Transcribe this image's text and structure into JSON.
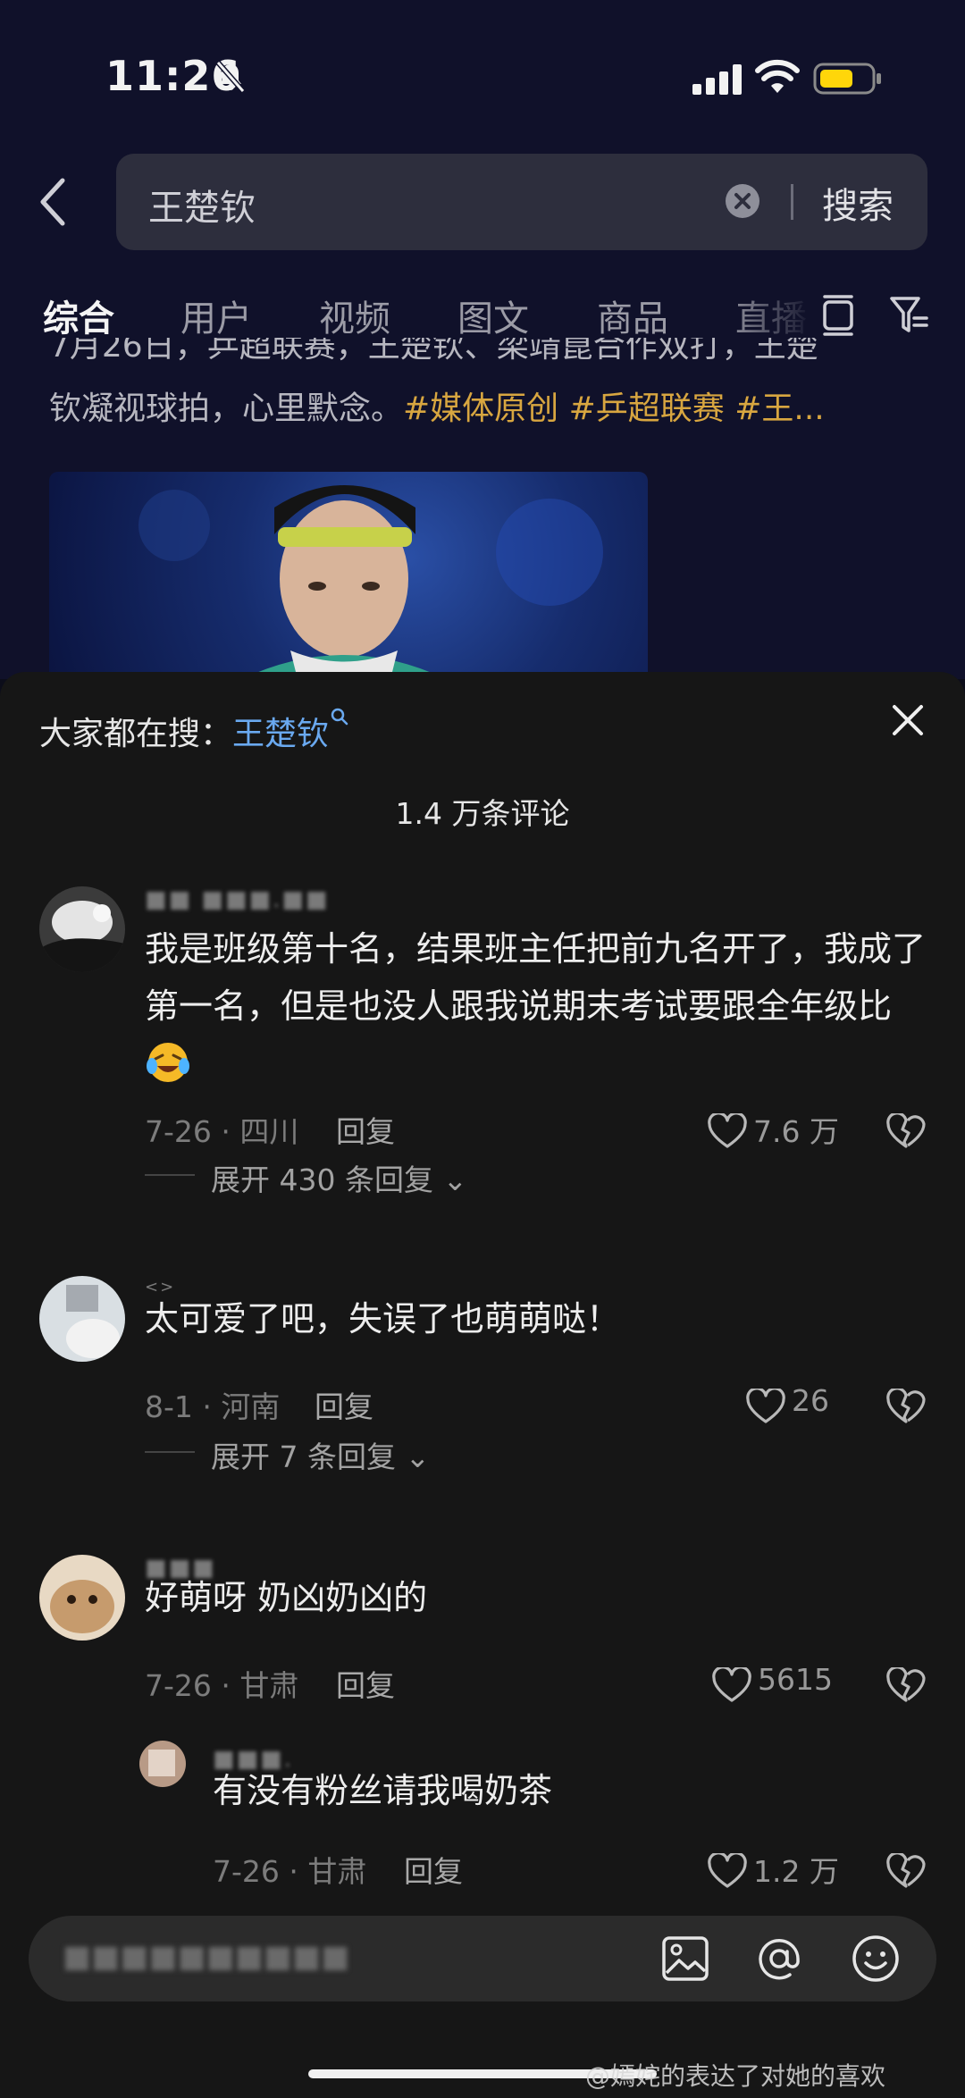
{
  "status_bar": {
    "time": "11:26"
  },
  "search": {
    "query": "王楚钦",
    "button": "搜索"
  },
  "tabs": [
    "综合",
    "用户",
    "视频",
    "图文",
    "商品",
    "直播"
  ],
  "post": {
    "line1": "7月26日，乒超联赛，王楚钦、梁靖崑合作双打，王楚",
    "line2": "钦凝视球拍，心里默念。",
    "tags": "#媒体原创 #乒超联赛 #王..."
  },
  "sheet": {
    "hot_search_label": "大家都在搜：",
    "hot_search_keyword": "王楚钦",
    "comment_count": "1.4 万条评论"
  },
  "comments": [
    {
      "username": "■■ ■■■.■■",
      "text": "我是班级第十名，结果班主任把前九名开了，我成了第一名，但是也没人跟我说期末考试要跟全年级比",
      "meta": "7-26 · 四川",
      "reply": "回复",
      "likes": "7.6 万",
      "expand": "展开 430 条回复"
    },
    {
      "username": "<>",
      "text": "太可爱了吧，失误了也萌萌哒！",
      "meta": "8-1 · 河南",
      "reply": "回复",
      "likes": "26",
      "expand": "展开 7 条回复"
    },
    {
      "username": "■■■",
      "text": "好萌呀 奶凶奶凶的",
      "meta": "7-26 · 甘肃",
      "reply": "回复",
      "likes": "5615"
    },
    {
      "username": "■■■.",
      "text": "有没有粉丝请我喝奶茶",
      "meta": "7-26 · 甘肃",
      "reply": "回复",
      "likes": "1.2 万"
    }
  ],
  "input": {
    "placeholder": "■■■■■■■■■■"
  },
  "watermark": "@嫣姹的表达了对她的喜欢"
}
